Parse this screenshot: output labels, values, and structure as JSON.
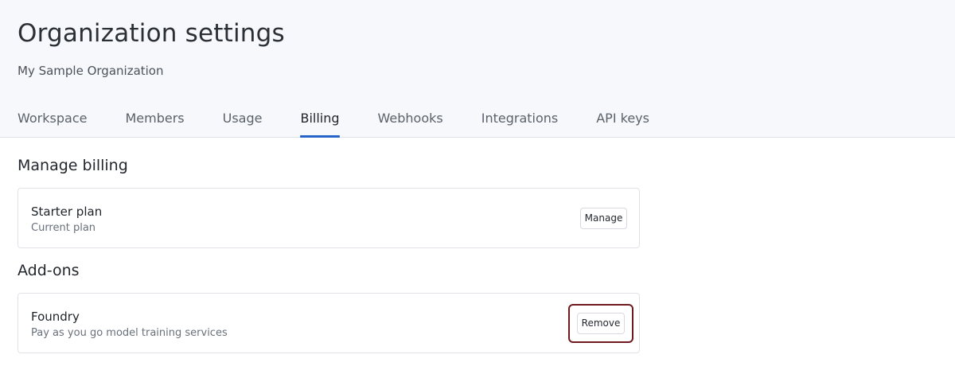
{
  "header": {
    "title": "Organization settings",
    "org_name": "My Sample Organization"
  },
  "tabs": [
    {
      "label": "Workspace",
      "active": false
    },
    {
      "label": "Members",
      "active": false
    },
    {
      "label": "Usage",
      "active": false
    },
    {
      "label": "Billing",
      "active": true
    },
    {
      "label": "Webhooks",
      "active": false
    },
    {
      "label": "Integrations",
      "active": false
    },
    {
      "label": "API keys",
      "active": false
    }
  ],
  "billing": {
    "section_title": "Manage billing",
    "plan_name": "Starter plan",
    "plan_sub": "Current plan",
    "manage_label": "Manage"
  },
  "addons": {
    "section_title": "Add-ons",
    "items": [
      {
        "name": "Foundry",
        "description": "Pay as you go model training services",
        "remove_label": "Remove"
      }
    ]
  },
  "colors": {
    "accent": "#2563c9",
    "focus_outline": "#6e1a1f",
    "header_bg": "#f6f8fc"
  }
}
